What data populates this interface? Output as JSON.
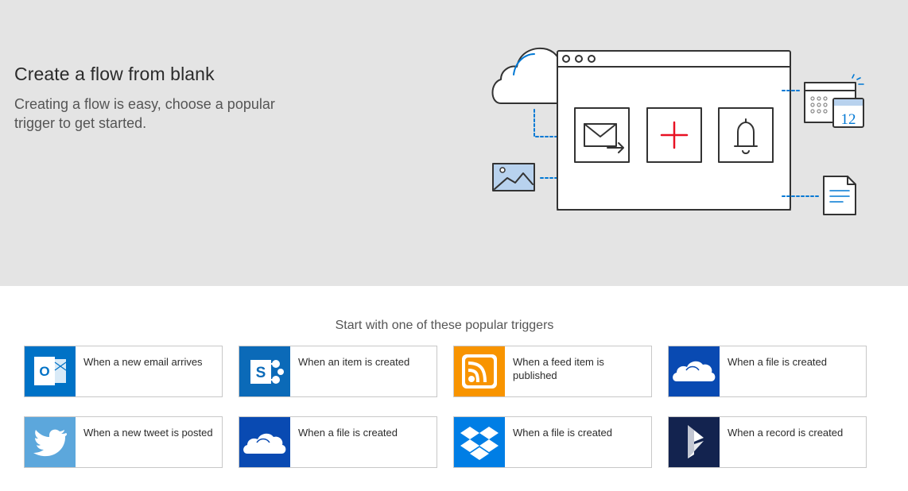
{
  "hero": {
    "title": "Create a flow from blank",
    "subtitle": "Creating a flow is easy, choose a popular trigger to get started.",
    "calendar_number": "12",
    "background_color": "#e4e4e4",
    "accent_color": "#0078d4",
    "plus_color": "#e81123"
  },
  "triggers_section": {
    "heading": "Start with one of these popular triggers"
  },
  "triggers": [
    {
      "label": "When a new email arrives",
      "service": "outlook",
      "icon": "outlook-icon",
      "color": "#0072c6"
    },
    {
      "label": "When an item is created",
      "service": "sharepoint",
      "icon": "sharepoint-icon",
      "color": "#0b6ab8"
    },
    {
      "label": "When a feed item is published",
      "service": "rss",
      "icon": "rss-icon",
      "color": "#f89400"
    },
    {
      "label": "When a file is created",
      "service": "onedrive",
      "icon": "onedrive-icon",
      "color": "#094ab2"
    },
    {
      "label": "When a new tweet is posted",
      "service": "twitter",
      "icon": "twitter-icon",
      "color": "#5ca7dc"
    },
    {
      "label": "When a file is created",
      "service": "onedrive-for-business",
      "icon": "onedrive-business-icon",
      "color": "#094ab2"
    },
    {
      "label": "When a file is created",
      "service": "dropbox",
      "icon": "dropbox-icon",
      "color": "#007ee5"
    },
    {
      "label": "When a record is created",
      "service": "dynamics",
      "icon": "dynamics-icon",
      "color": "#13234f"
    }
  ]
}
